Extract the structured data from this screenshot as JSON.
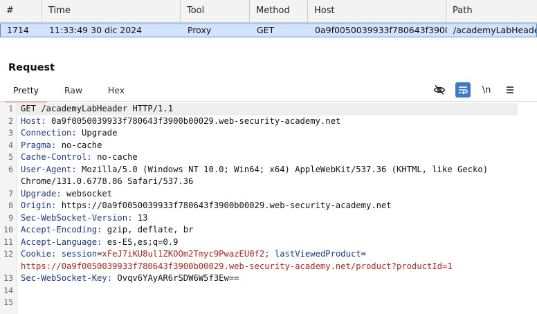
{
  "history": {
    "headers": [
      "#",
      "Time",
      "Tool",
      "Method",
      "Host",
      "Path"
    ],
    "row": {
      "num": "1714",
      "time": "11:33:49 30 dic 2024",
      "tool": "Proxy",
      "method": "GET",
      "host": "0a9f0050039933f780643f3900",
      "path": "/academyLabHeader"
    }
  },
  "request": {
    "title": "Request",
    "tabs": [
      "Pretty",
      "Raw",
      "Hex"
    ],
    "tools": {
      "newline_label": "\\n"
    },
    "line_numbers": [
      "1",
      "2",
      "3",
      "4",
      "5",
      "6",
      "",
      "7",
      "8",
      "9",
      "10",
      "11",
      "12",
      "",
      "13",
      "14",
      "15"
    ],
    "lines": {
      "l1": "GET /academyLabHeader HTTP/1.1",
      "l2k": "Host:",
      "l2v": " 0a9f0050039933f780643f3900b00029.web-security-academy.net",
      "l3k": "Connection:",
      "l3v": " Upgrade",
      "l4k": "Pragma:",
      "l4v": " no-cache",
      "l5k": "Cache-Control:",
      "l5v": " no-cache",
      "l6k": "User-Agent:",
      "l6v": " Mozilla/5.0 (Windows NT 10.0; Win64; x64) AppleWebKit/537.36 (KHTML, like Gecko)",
      "l6c": "Chrome/131.0.6778.86 Safari/537.36",
      "l7k": "Upgrade:",
      "l7v": " websocket",
      "l8k": "Origin:",
      "l8v": " https://0a9f0050039933f780643f3900b00029.web-security-academy.net",
      "l9k": "Sec-WebSocket-Version:",
      "l9v": " 13",
      "l10k": "Accept-Encoding:",
      "l10v": " gzip, deflate, br",
      "l11k": "Accept-Language:",
      "l11v": " es-ES,es;q=0.9",
      "l12k": "Cookie:",
      "l12a": " session",
      "l12b": "=",
      "l12c": "xFeJ7iKU8ul1ZKOOm2Tmyc9PwazEU0f2",
      "l12d": "; lastViewedProduct",
      "l12e": "=",
      "l12f": "https://0a9f0050039933f780643f3900b00029.web-security-academy.net/product?productId=1",
      "l13k": "Sec-WebSocket-Key:",
      "l13v": " Ovqv6YAyAR6rSDW6W5f3Ew=="
    }
  },
  "colors": {
    "accent": "#e8692b",
    "selected_row": "#d2e3fb",
    "header_key": "#1b3a8a",
    "cookie_value": "#b3261e"
  }
}
